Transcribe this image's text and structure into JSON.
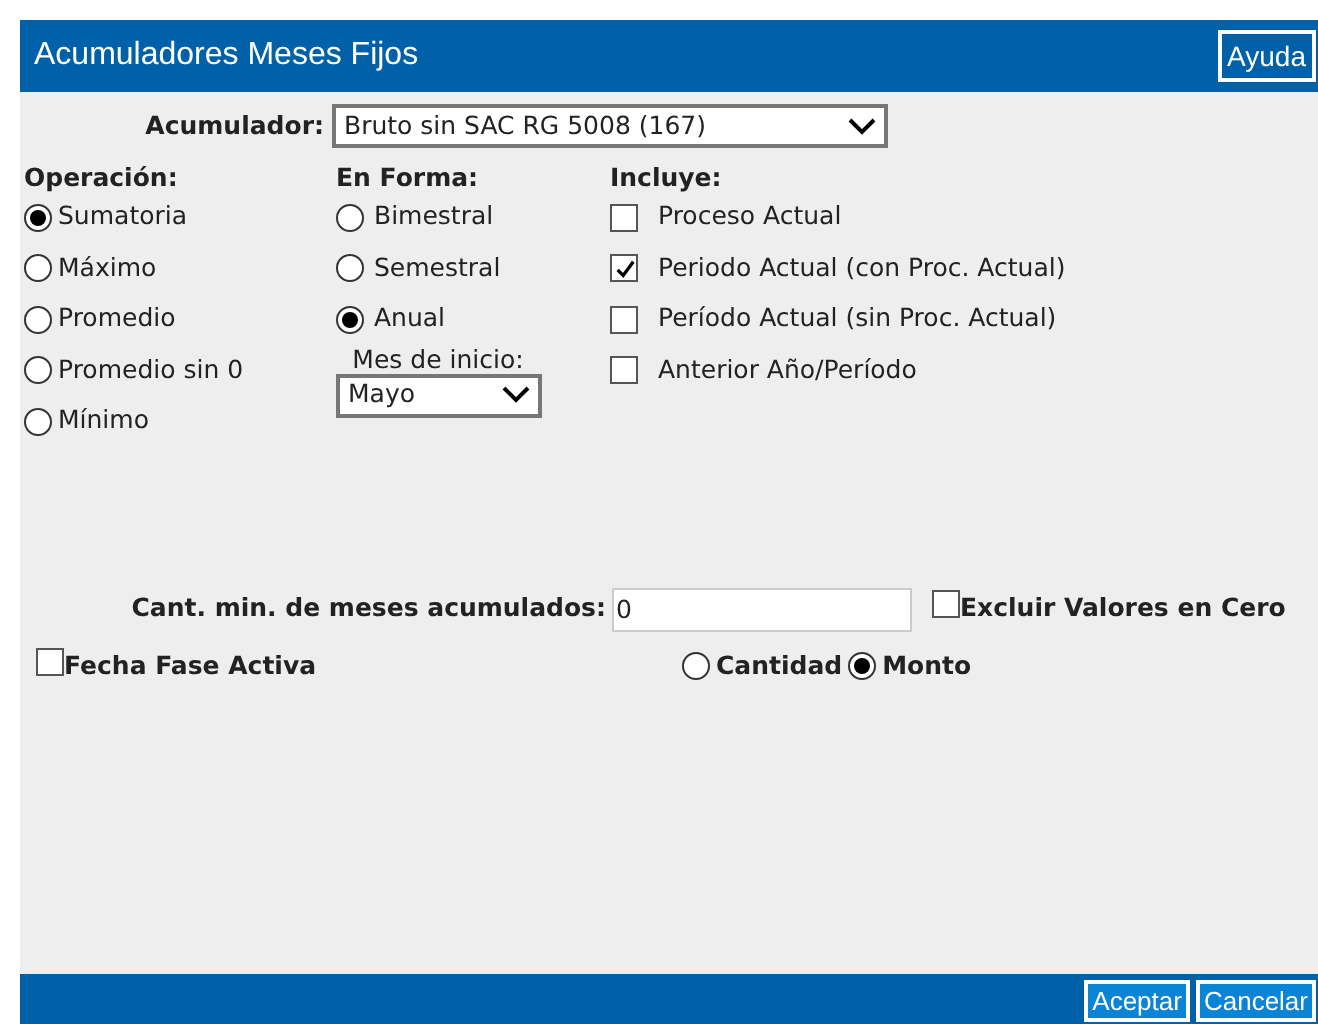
{
  "window": {
    "title": "Acumuladores Meses Fijos",
    "help_button": "Ayuda"
  },
  "acumulador": {
    "label": "Acumulador:",
    "value": "Bruto sin SAC RG 5008 (167)"
  },
  "operacion": {
    "label": "Operación:",
    "options": [
      {
        "label": "Sumatoria",
        "selected": true
      },
      {
        "label": "Máximo",
        "selected": false
      },
      {
        "label": "Promedio",
        "selected": false
      },
      {
        "label": "Promedio sin 0",
        "selected": false
      },
      {
        "label": "Mínimo",
        "selected": false
      }
    ]
  },
  "en_forma": {
    "label": "En Forma:",
    "options": [
      {
        "label": "Bimestral",
        "selected": false
      },
      {
        "label": "Semestral",
        "selected": false
      },
      {
        "label": "Anual",
        "selected": true
      }
    ],
    "mes_inicio": {
      "label": "Mes de inicio:",
      "value": "Mayo"
    }
  },
  "incluye": {
    "label": "Incluye:",
    "options": [
      {
        "label": "Proceso Actual",
        "checked": false
      },
      {
        "label": "Periodo Actual (con Proc. Actual)",
        "checked": true
      },
      {
        "label": "Período Actual (sin Proc. Actual)",
        "checked": false
      },
      {
        "label": "Anterior Año/Período",
        "checked": false
      }
    ]
  },
  "cant_min": {
    "label": "Cant. min. de meses acumulados:",
    "value": "0"
  },
  "excluir_ceros": {
    "label": "Excluir Valores en Cero",
    "checked": false
  },
  "fecha_fase_activa": {
    "label": "Fecha Fase Activa",
    "checked": false
  },
  "tipo": [
    {
      "label": "Cantidad",
      "selected": false
    },
    {
      "label": "Monto",
      "selected": true
    }
  ],
  "footer_buttons": [
    "Aceptar",
    "Cancelar"
  ]
}
